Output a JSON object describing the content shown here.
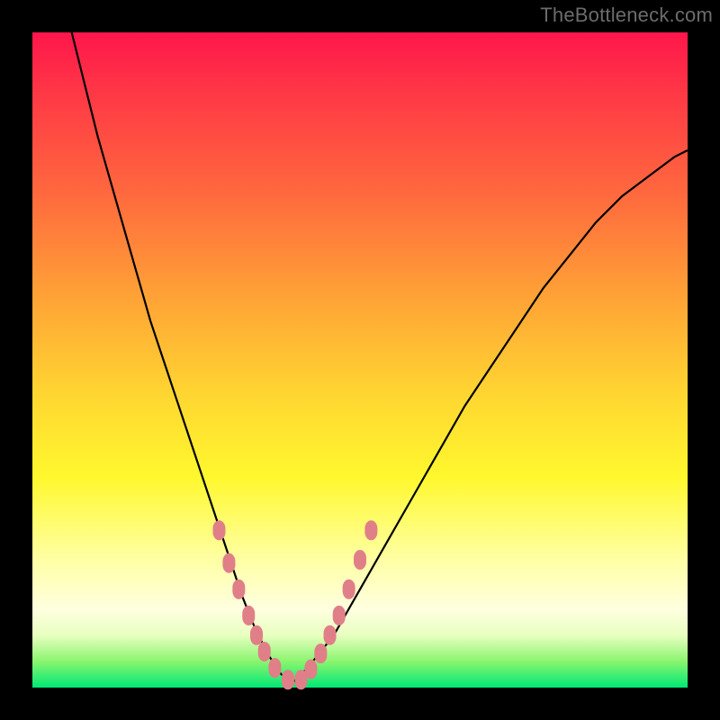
{
  "watermark": "TheBottleneck.com",
  "colors": {
    "marker": "#e07f88",
    "curve": "#000000"
  },
  "chart_data": {
    "type": "line",
    "title": "",
    "xlabel": "",
    "ylabel": "",
    "xlim": [
      0,
      100
    ],
    "ylim": [
      0,
      100
    ],
    "series": [
      {
        "name": "bottleneck-curve",
        "x": [
          6,
          8,
          10,
          12,
          14,
          16,
          18,
          20,
          22,
          24,
          26,
          28,
          30,
          32,
          34,
          36,
          38,
          40,
          42,
          46,
          50,
          54,
          58,
          62,
          66,
          70,
          74,
          78,
          82,
          86,
          90,
          94,
          98,
          100
        ],
        "y": [
          100,
          92,
          84,
          77,
          70,
          63,
          56,
          50,
          44,
          38,
          32,
          26,
          20,
          14,
          9,
          5,
          2,
          1,
          3,
          8,
          15,
          22,
          29,
          36,
          43,
          49,
          55,
          61,
          66,
          71,
          75,
          78,
          81,
          82
        ]
      }
    ],
    "markers": {
      "name": "highlight-dots",
      "x": [
        28.5,
        30,
        31.5,
        33,
        34.2,
        35.4,
        37,
        39,
        41,
        42.5,
        44,
        45.4,
        46.8,
        48.3,
        50,
        51.7
      ],
      "y": [
        24,
        19,
        15,
        11,
        8,
        5.5,
        3,
        1.2,
        1.2,
        2.8,
        5.2,
        8,
        11,
        15,
        19.5,
        24
      ]
    }
  }
}
